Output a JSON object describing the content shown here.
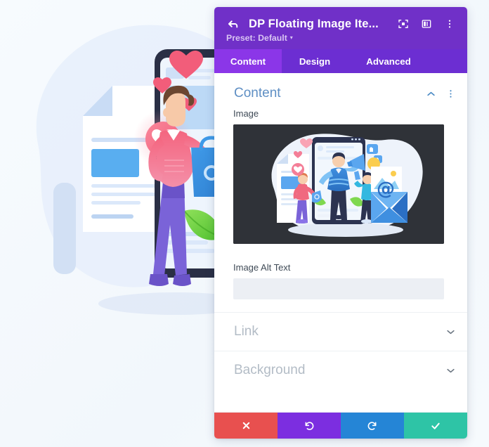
{
  "app": {
    "background_color": "#f6fafd"
  },
  "panel": {
    "header": {
      "back_icon": "back-arrow-icon",
      "title": "DP Floating Image Ite...",
      "preset_label": "Preset: Default",
      "preset_caret": "▾",
      "icons": [
        {
          "name": "focus-target-icon",
          "label": "Focus"
        },
        {
          "name": "layout-columns-icon",
          "label": "Layout"
        },
        {
          "name": "kebab-menu-icon",
          "label": "More options"
        }
      ],
      "bg_color": "#7030c8"
    },
    "tabs": [
      {
        "label": "Content",
        "active": true
      },
      {
        "label": "Design",
        "active": false
      },
      {
        "label": "Advanced",
        "active": false
      }
    ],
    "tab_bar_color": "#6c2ed2",
    "tab_active_color": "#8b36e8",
    "content_section": {
      "title": "Content",
      "collapse_icon": "chevron-up-icon",
      "options_icon": "kebab-menu-icon",
      "accent_color": "#5f8fc4",
      "fields": [
        {
          "label": "Image",
          "type": "image-upload",
          "preview_bg": "#2f3238",
          "preview_alt": "marketing team illustration with smartphone, megaphone and envelope"
        },
        {
          "label": "Image Alt Text",
          "type": "text",
          "value": "",
          "placeholder": ""
        }
      ]
    },
    "collapsed_sections": [
      {
        "title": "Link",
        "icon": "chevron-down-icon"
      },
      {
        "title": "Background",
        "icon": "chevron-down-icon"
      }
    ],
    "footer_buttons": [
      {
        "name": "cancel-button",
        "icon": "close-x-icon",
        "color": "#e8504f"
      },
      {
        "name": "undo-button",
        "icon": "undo-arrow-icon",
        "color": "#7c2ee0"
      },
      {
        "name": "redo-button",
        "icon": "redo-arrow-icon",
        "color": "#2585d6"
      },
      {
        "name": "save-button",
        "icon": "checkmark-icon",
        "color": "#2ec4a6"
      }
    ]
  },
  "canvas": {
    "illustration_alt": "person holding shopping bag with floating hearts beside a smartphone and document"
  }
}
